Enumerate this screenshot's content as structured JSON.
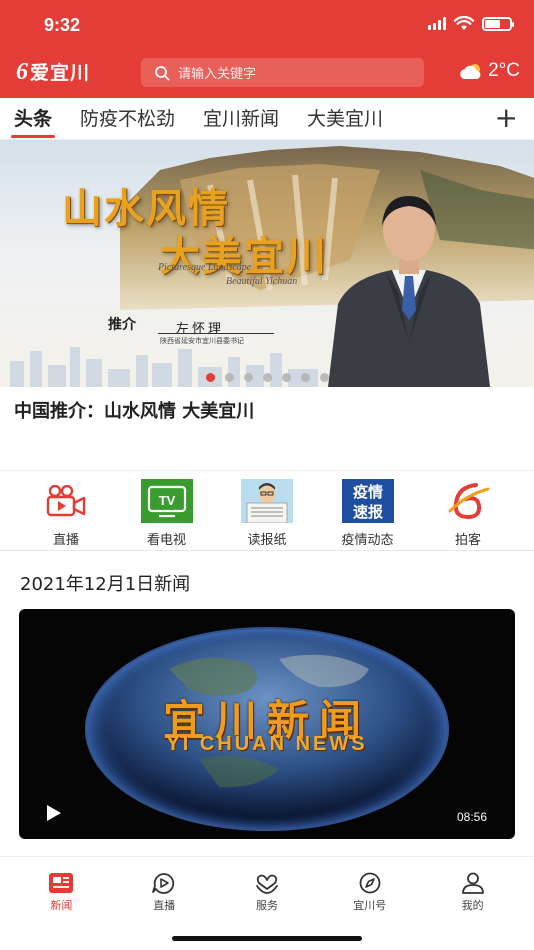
{
  "status_bar": {
    "time": "9:32"
  },
  "header": {
    "logo_mark": "6",
    "logo_text": "爱宜川",
    "search_placeholder": "请输入关键字",
    "weather_icon": "cloud-icon",
    "weather_temp": "2°C",
    "accent_color": "#e43c36"
  },
  "tabs": [
    {
      "label": "头条",
      "active": true
    },
    {
      "label": "防疫不松劲",
      "active": false
    },
    {
      "label": "宜川新闻",
      "active": false
    },
    {
      "label": "大美宜川",
      "active": false
    }
  ],
  "tabs_add": "+",
  "banner": {
    "title_line1": "山水风情",
    "title_line2": "大美宜川",
    "en_line1": "Picturesque Landscape",
    "en_line2": "Beautiful Yichuan",
    "recommend_label": "推介",
    "person_name": "左怀理",
    "person_role": "陕西省延安市宜川县委书记",
    "caption": "中国推介：山水风情  大美宜川",
    "slide_count": 7,
    "active_slide": 1
  },
  "quick_links": [
    {
      "label": "直播",
      "icon": "video-camera-icon"
    },
    {
      "label": "看电视",
      "icon": "tv-icon",
      "icon_text": "TV"
    },
    {
      "label": "读报纸",
      "icon": "newspaper-reader-icon"
    },
    {
      "label": "疫情动态",
      "icon": "epidemic-report-icon",
      "icon_text_1": "疫情",
      "icon_text_2": "速报"
    },
    {
      "label": "拍客",
      "icon": "paike-logo-icon"
    }
  ],
  "news_section": {
    "date_title": "2021年12月1日新闻",
    "video_title_cn": "宜川新闻",
    "video_title_en": "YI CHUAN NEWS",
    "video_duration": "08:56"
  },
  "bottom_nav": [
    {
      "label": "新闻",
      "icon": "news-icon",
      "active": true
    },
    {
      "label": "直播",
      "icon": "live-play-icon",
      "active": false
    },
    {
      "label": "服务",
      "icon": "service-heart-icon",
      "active": false
    },
    {
      "label": "宜川号",
      "icon": "compass-icon",
      "active": false
    },
    {
      "label": "我的",
      "icon": "user-icon",
      "active": false
    }
  ]
}
